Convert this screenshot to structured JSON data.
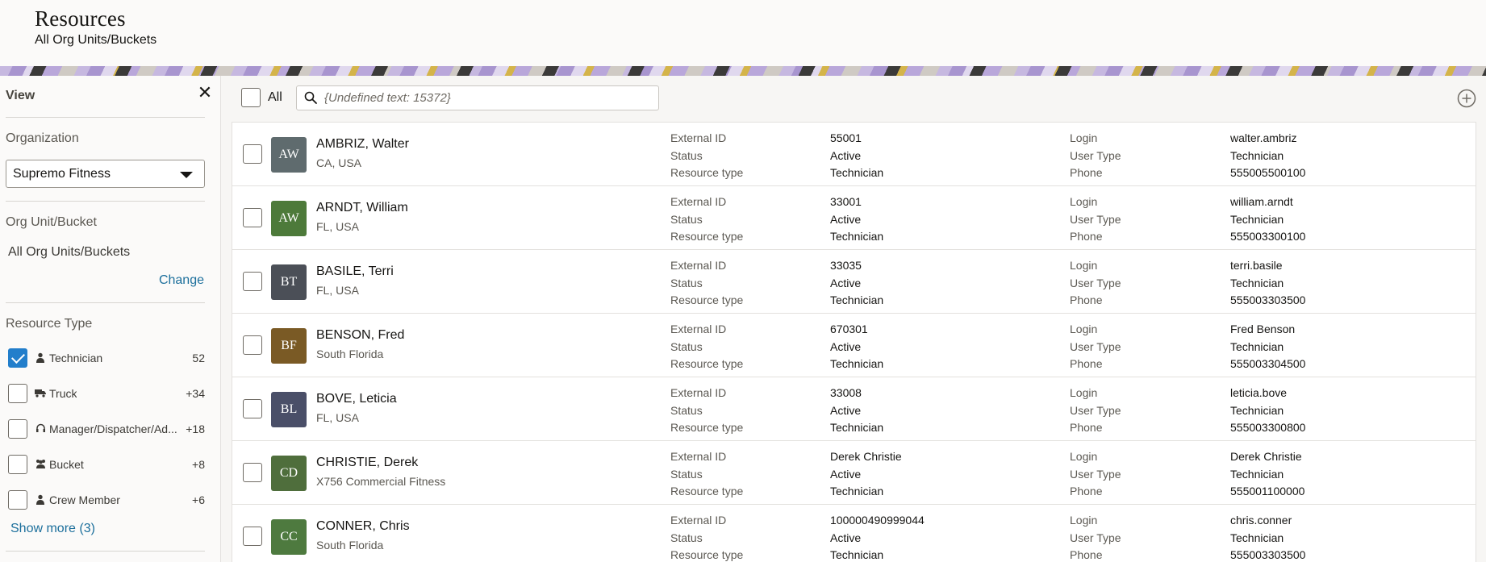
{
  "header": {
    "title": "Resources",
    "subtitle": "All Org Units/Buckets"
  },
  "sidebar": {
    "title": "View",
    "close_icon": "close-icon",
    "organization": {
      "label": "Organization",
      "value": "Supremo Fitness"
    },
    "org_unit": {
      "label": "Org Unit/Bucket",
      "value": "All Org Units/Buckets",
      "change_label": "Change"
    },
    "resource_type": {
      "label": "Resource Type",
      "items": [
        {
          "label": "Technician",
          "count": "52",
          "checked": true,
          "icon": "person-icon"
        },
        {
          "label": "Truck",
          "count": "+34",
          "checked": false,
          "icon": "truck-icon"
        },
        {
          "label": "Manager/Dispatcher/Ad...",
          "count": "+18",
          "checked": false,
          "icon": "headset-icon"
        },
        {
          "label": "Bucket",
          "count": "+8",
          "checked": false,
          "icon": "group-icon"
        },
        {
          "label": "Crew Member",
          "count": "+6",
          "checked": false,
          "icon": "person-icon"
        }
      ],
      "show_more": "Show more (3)"
    }
  },
  "toolbar": {
    "all_label": "All",
    "search_placeholder": "{Undefined text: 15372}",
    "search_value": "",
    "add_icon": "add-circle-icon"
  },
  "field_labels": {
    "external_id": "External ID",
    "status": "Status",
    "resource_type": "Resource type",
    "login": "Login",
    "user_type": "User Type",
    "phone": "Phone"
  },
  "resources": [
    {
      "initials": "AW",
      "name": "AMBRIZ, Walter",
      "location": "CA, USA",
      "external_id": "55001",
      "status": "Active",
      "resource_type": "Technician",
      "login": "walter.ambriz",
      "user_type": "Technician",
      "phone": "555005500100",
      "avatar_color": "#5f6b6e"
    },
    {
      "initials": "AW",
      "name": "ARNDT, William",
      "location": "FL, USA",
      "external_id": "33001",
      "status": "Active",
      "resource_type": "Technician",
      "login": "william.arndt",
      "user_type": "Technician",
      "phone": "555003300100",
      "avatar_color": "#4d7a3a"
    },
    {
      "initials": "BT",
      "name": "BASILE, Terri",
      "location": "FL, USA",
      "external_id": "33035",
      "status": "Active",
      "resource_type": "Technician",
      "login": "terri.basile",
      "user_type": "Technician",
      "phone": "555003303500",
      "avatar_color": "#4b4f57"
    },
    {
      "initials": "BF",
      "name": "BENSON, Fred",
      "location": "South Florida",
      "external_id": "670301",
      "status": "Active",
      "resource_type": "Technician",
      "login": "Fred Benson",
      "user_type": "Technician",
      "phone": "555003304500",
      "avatar_color": "#7a5a25"
    },
    {
      "initials": "BL",
      "name": "BOVE, Leticia",
      "location": "FL, USA",
      "external_id": "33008",
      "status": "Active",
      "resource_type": "Technician",
      "login": "leticia.bove",
      "user_type": "Technician",
      "phone": "555003300800",
      "avatar_color": "#4a4f68"
    },
    {
      "initials": "CD",
      "name": "CHRISTIE, Derek",
      "location": "X756 Commercial Fitness",
      "external_id": "Derek Christie",
      "status": "Active",
      "resource_type": "Technician",
      "login": "Derek Christie",
      "user_type": "Technician",
      "phone": "555001100000",
      "avatar_color": "#4f6e3c"
    },
    {
      "initials": "CC",
      "name": "CONNER, Chris",
      "location": "South Florida",
      "external_id": "100000490999044",
      "status": "Active",
      "resource_type": "Technician",
      "login": "chris.conner",
      "user_type": "Technician",
      "phone": "555003303500",
      "avatar_color": "#4e7a3f"
    }
  ]
}
